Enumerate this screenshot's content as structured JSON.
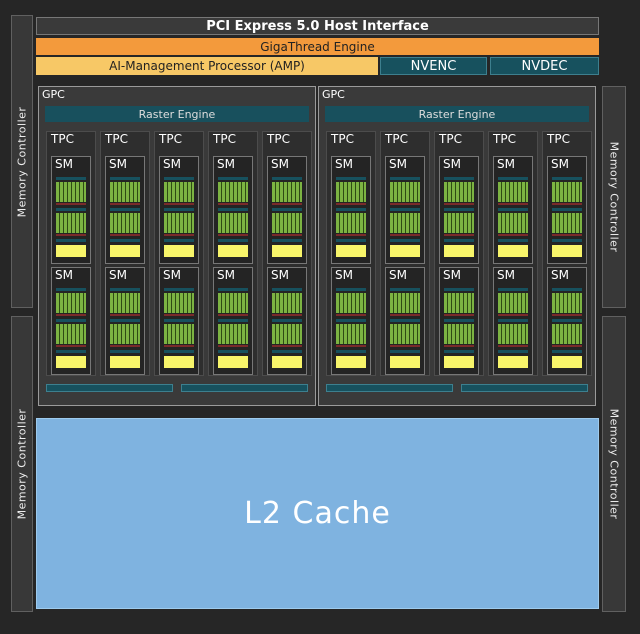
{
  "host_interface": {
    "label": "PCI Express 5.0 Host Interface"
  },
  "gigathread": {
    "label": "GigaThread Engine"
  },
  "amp": {
    "label": "AI-Management Processor (AMP)"
  },
  "nvenc": {
    "label": "NVENC"
  },
  "nvdec": {
    "label": "NVDEC"
  },
  "memory_controller": {
    "label": "Memory Controller"
  },
  "gpcs": [
    {
      "label": "GPC",
      "raster_engine": "Raster Engine",
      "tpcs": [
        {
          "label": "TPC",
          "sms": [
            "SM",
            "SM"
          ]
        },
        {
          "label": "TPC",
          "sms": [
            "SM",
            "SM"
          ]
        },
        {
          "label": "TPC",
          "sms": [
            "SM",
            "SM"
          ]
        },
        {
          "label": "TPC",
          "sms": [
            "SM",
            "SM"
          ]
        },
        {
          "label": "TPC",
          "sms": [
            "SM",
            "SM"
          ]
        }
      ]
    },
    {
      "label": "GPC",
      "raster_engine": "Raster Engine",
      "tpcs": [
        {
          "label": "TPC",
          "sms": [
            "SM",
            "SM"
          ]
        },
        {
          "label": "TPC",
          "sms": [
            "SM",
            "SM"
          ]
        },
        {
          "label": "TPC",
          "sms": [
            "SM",
            "SM"
          ]
        },
        {
          "label": "TPC",
          "sms": [
            "SM",
            "SM"
          ]
        },
        {
          "label": "TPC",
          "sms": [
            "SM",
            "SM"
          ]
        }
      ]
    }
  ],
  "l2_cache": {
    "label": "L2 Cache"
  },
  "colors": {
    "background": "#262626",
    "gigathread": "#f39a3c",
    "amp": "#f7c866",
    "teal": "#17515e",
    "cuda_core": "#7cb342",
    "sm_block": "#f8f56a",
    "l2_cache": "#7fb3e0"
  }
}
